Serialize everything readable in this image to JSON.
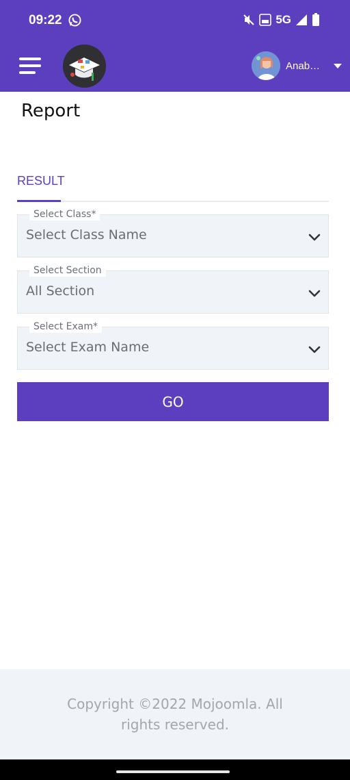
{
  "status_bar": {
    "time": "09:22",
    "network": "5G",
    "icons": [
      "whatsapp-icon",
      "mute-icon",
      "volte-icon",
      "signal-icon",
      "battery-icon"
    ]
  },
  "app_bar": {
    "menu_icon": "hamburger-icon",
    "logo": "school-logo",
    "user_name": "Anabe…",
    "user_caret": "caret-down-icon"
  },
  "page": {
    "title": "Report"
  },
  "tabs": [
    {
      "label": "RESULT",
      "active": true
    }
  ],
  "form": {
    "class_field": {
      "label": "Select Class*",
      "value": "Select Class Name"
    },
    "section_field": {
      "label": "Select Section",
      "value": "All Section"
    },
    "exam_field": {
      "label": "Select Exam*",
      "value": "Select Exam Name"
    },
    "go_label": "GO"
  },
  "footer": {
    "text": "Copyright ©2022 Mojoomla. All rights reserved."
  },
  "colors": {
    "primary": "#5c3fbf",
    "field_bg": "#f0f3f8",
    "footer_text": "#a3a6ab"
  }
}
